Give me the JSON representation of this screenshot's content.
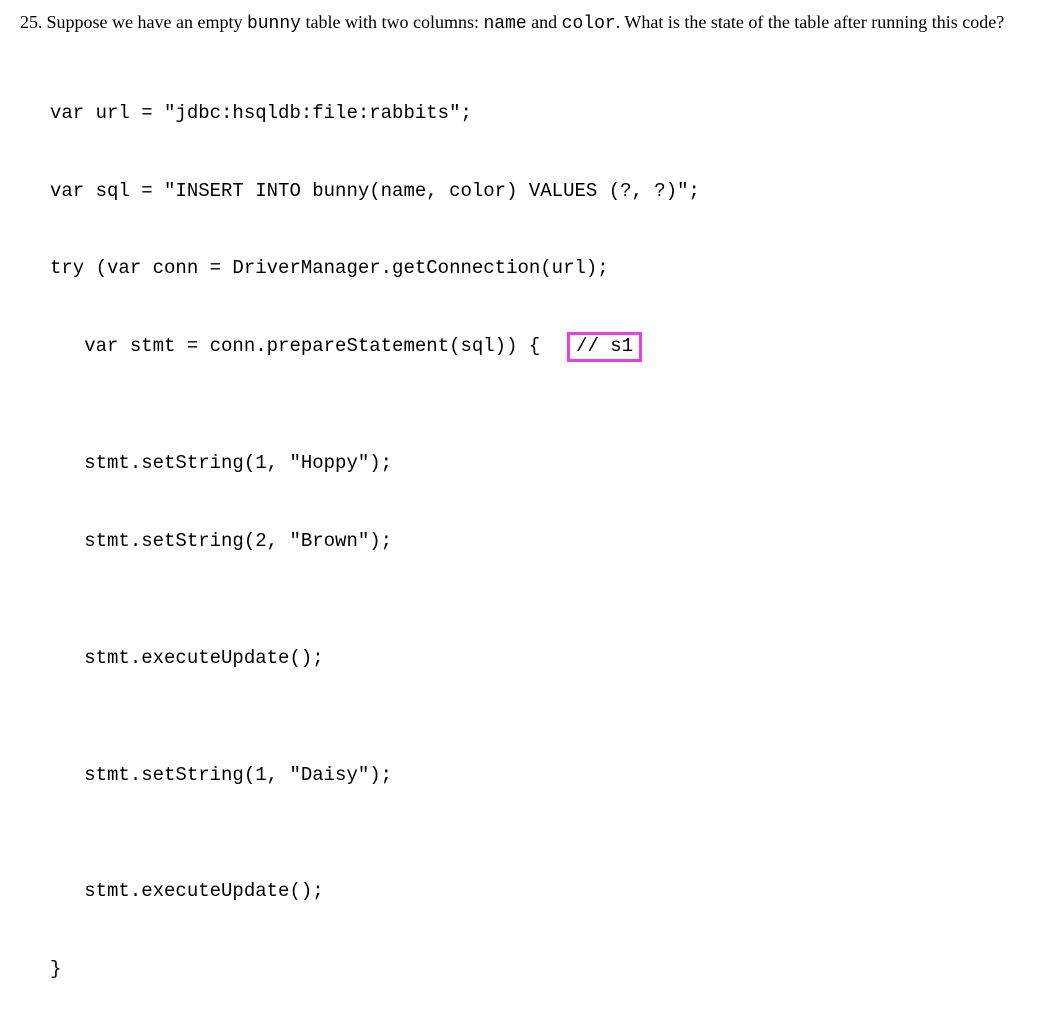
{
  "question": {
    "number": "25.",
    "prefix": "Suppose we have an empty ",
    "inline1": "bunny",
    "mid1": " table with two columns: ",
    "inline2": "name",
    "mid2": " and ",
    "inline3": "color",
    "suffix": ". What is the state of the table after running this code?"
  },
  "code": {
    "l1": "var url = \"jdbc:hsqldb:file:rabbits\";",
    "l2": "var sql = \"INSERT INTO bunny(name, color) VALUES (?, ?)\";",
    "l3": "try (var conn = DriverManager.getConnection(url);",
    "l4": "   var stmt = conn.prepareStatement(sql)) {  ",
    "l4_hl": "// s1",
    "l5": "   stmt.setString(1, \"Hoppy\");",
    "l6": "   stmt.setString(2, \"Brown\");",
    "l7": "   stmt.executeUpdate();",
    "l8": "   stmt.setString(1, \"Daisy\");",
    "l9": "   stmt.executeUpdate();",
    "l10": "}"
  }
}
